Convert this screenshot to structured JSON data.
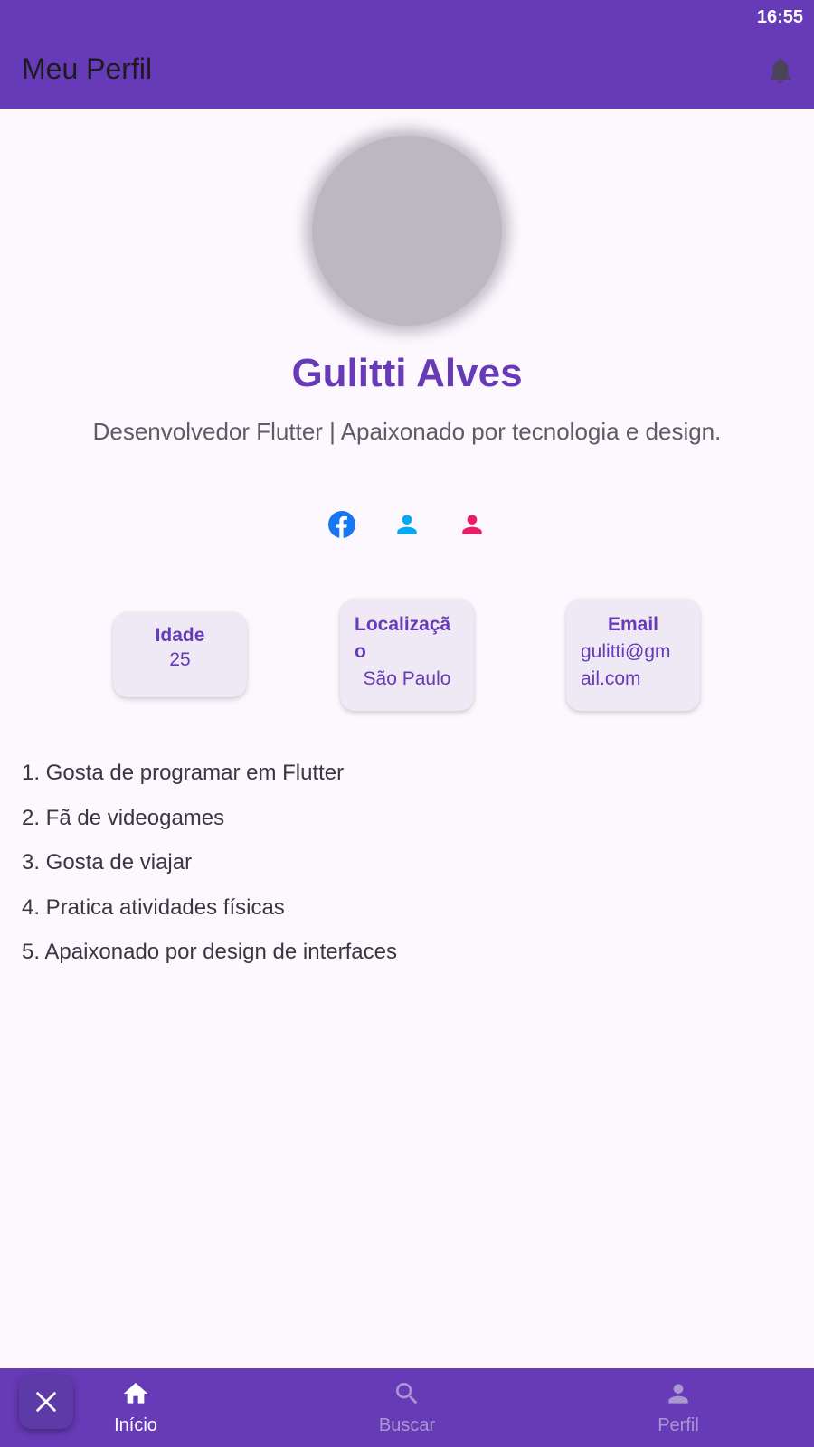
{
  "status_bar": {
    "time": "16:55"
  },
  "app_bar": {
    "title": "Meu Perfil",
    "notification_icon": "bell-icon"
  },
  "profile": {
    "name": "Gulitti Alves",
    "bio": "Desenvolvedor Flutter | Apaixonado por tecnologia e design."
  },
  "social": [
    {
      "icon": "facebook-icon",
      "color": "#1877f2"
    },
    {
      "icon": "person-icon",
      "color": "#03a9f4"
    },
    {
      "icon": "person-icon",
      "color": "#e91e63"
    }
  ],
  "info_cards": [
    {
      "label": "Idade",
      "value": "25"
    },
    {
      "label_line1": "Localizaçã",
      "label_line2": "o",
      "value": "São Paulo"
    },
    {
      "label": "Email",
      "value_line1": "gulitti@gm",
      "value_line2": "ail.com"
    }
  ],
  "facts": [
    "1. Gosta de programar em Flutter",
    "2. Fã de videogames",
    "3. Gosta de viajar",
    "4. Pratica atividades físicas",
    "5. Apaixonado por design de interfaces"
  ],
  "bottom_nav": {
    "items": [
      {
        "label": "Início",
        "icon": "home-icon",
        "selected": true
      },
      {
        "label": "Buscar",
        "icon": "search-icon",
        "selected": false
      },
      {
        "label": "Perfil",
        "icon": "person-icon",
        "selected": false
      }
    ]
  },
  "fab": {
    "icon": "close-icon"
  },
  "colors": {
    "primary": "#673ab7",
    "background": "#fdf7fe",
    "card": "#efe9f5",
    "facebook": "#1877f2",
    "social_blue": "#03a9f4",
    "social_pink": "#e91e63"
  }
}
